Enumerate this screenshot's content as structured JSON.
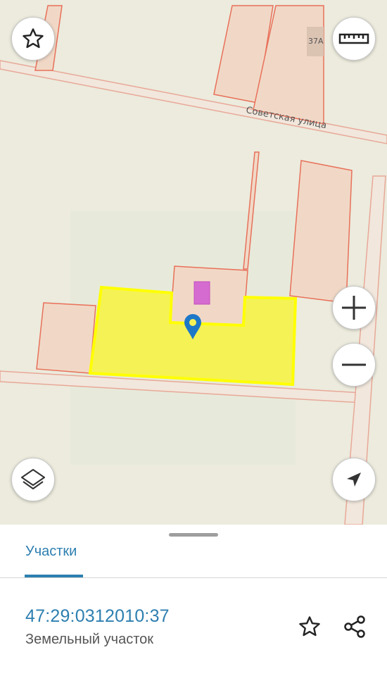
{
  "map": {
    "street_label": "Советская улица",
    "house_number": "37А",
    "colors": {
      "background": "#ecebdd",
      "parcel_fill": "#f1d8c6",
      "parcel_stroke": "#e8705a",
      "selected_fill": "#f5f256",
      "selected_stroke": "#ffff00",
      "building": "#d56bd0",
      "marker": "#1e78c8"
    }
  },
  "controls": {
    "favorite_icon": "star-outline-icon",
    "ruler_icon": "ruler-icon",
    "zoom_in_icon": "plus-icon",
    "zoom_out_icon": "minus-icon",
    "layers_icon": "layers-icon",
    "locate_icon": "navigation-arrow-icon"
  },
  "sheet": {
    "tab_label": "Участки",
    "cadastral_number": "47:29:0312010:37",
    "property_type": "Земельный участок",
    "favorite_icon": "star-outline-icon",
    "share_icon": "share-icon"
  }
}
